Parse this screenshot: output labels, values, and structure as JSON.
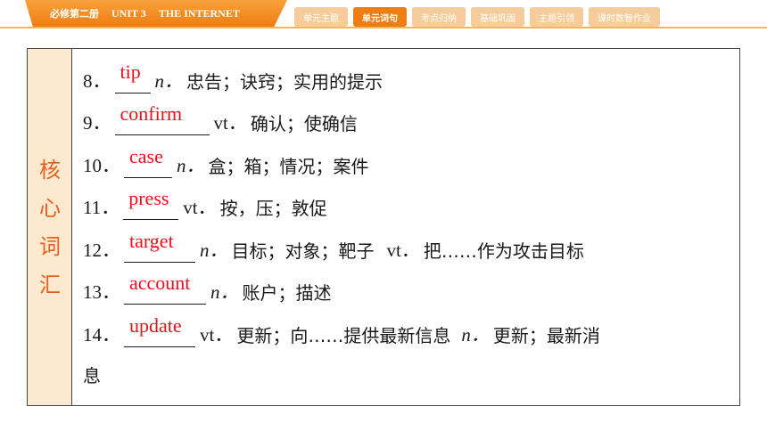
{
  "header": {
    "book": "必修第二册",
    "unit": "UNIT 3",
    "unit_title": "THE INTERNET",
    "tabs": [
      {
        "label": "单元主题",
        "active": false
      },
      {
        "label": "单元词句",
        "active": true
      },
      {
        "label": "考点归纳",
        "active": false
      },
      {
        "label": "基础巩固",
        "active": false
      },
      {
        "label": "主题引领",
        "active": false
      },
      {
        "label": "课时数智作业",
        "active": false
      }
    ]
  },
  "side_title": [
    "核",
    "心",
    "词",
    "汇"
  ],
  "vocab": [
    {
      "num": "8．",
      "answer": "tip",
      "pos": "n．",
      "meaning": "忠告；诀窍；实用的提示"
    },
    {
      "num": "9．",
      "answer": "confirm",
      "pos": "vt．",
      "meaning": "确认；使确信"
    },
    {
      "num": "10．",
      "answer": "case",
      "pos": "n．",
      "meaning": "盒；箱；情况；案件"
    },
    {
      "num": "11．",
      "answer": "press",
      "pos": "vt．",
      "meaning": "按，压；敦促"
    },
    {
      "num": "12．",
      "answer": "target",
      "pos": "n．",
      "meaning": "目标；对象；靶子",
      "pos2": "vt．",
      "meaning2": "把……作为攻击目标"
    },
    {
      "num": "13．",
      "answer": "account",
      "pos": "n．",
      "meaning": "账户；描述"
    },
    {
      "num": "14．",
      "answer": "update",
      "pos": "vt．",
      "meaning": "更新；向……提供最新信息",
      "pos2": "n．",
      "meaning2": "更新；最新消",
      "continuation": "息"
    }
  ],
  "colors": {
    "accent": "#ee7d12",
    "answer": "#e8101c",
    "side_bg": "#fde9cf",
    "side_text": "#e8601c"
  }
}
